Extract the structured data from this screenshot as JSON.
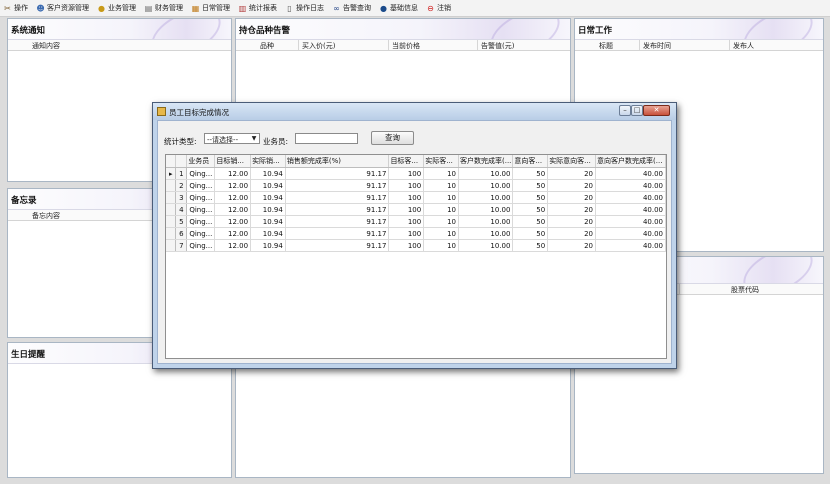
{
  "menubar": {
    "items": [
      {
        "label": "操作",
        "icon": "tools-icon"
      },
      {
        "label": "客户资源管理",
        "icon": "customers-icon"
      },
      {
        "label": "业务管理",
        "icon": "business-icon"
      },
      {
        "label": "财务管理",
        "icon": "finance-icon"
      },
      {
        "label": "日常管理",
        "icon": "daily-icon"
      },
      {
        "label": "统计报表",
        "icon": "chart-icon"
      },
      {
        "label": "操作日志",
        "icon": "log-icon"
      },
      {
        "label": "告警查询",
        "icon": "binoculars-icon"
      },
      {
        "label": "基础信息",
        "icon": "info-icon"
      },
      {
        "label": "注销",
        "icon": "logout-icon"
      }
    ]
  },
  "panels": {
    "notice": {
      "title": "系统通知",
      "columns": [
        "通知内容"
      ]
    },
    "holdings": {
      "title": "持仓品种告警",
      "columns": [
        "品种",
        "买入价(元)",
        "当前价格",
        "告警值(元)"
      ]
    },
    "daily": {
      "title": "日常工作",
      "columns": [
        "标题",
        "发布时间",
        "发布人"
      ]
    },
    "memo": {
      "title": "备忘录",
      "columns": [
        "备忘内容"
      ]
    },
    "stock": {
      "columns": [
        "股票代码"
      ]
    },
    "birthday": {
      "title": "生日提醒"
    }
  },
  "dialog": {
    "title": "员工目标完成情况",
    "filter": {
      "type_label": "统计类型:",
      "type_value": "--请选择--",
      "staff_label": "业务员:",
      "staff_value": "",
      "query_label": "查询"
    },
    "grid": {
      "columns": [
        "业务员",
        "目标销...",
        "实际销...",
        "销售额完成率(%)",
        "目标客...",
        "实际客...",
        "客户数完成率(...",
        "意向客...",
        "实际意向客...",
        "意向客户数完成率(..."
      ],
      "rows": [
        {
          "no": "1",
          "current": true,
          "cells": [
            "Qing...",
            "12.00",
            "10.94",
            "91.17",
            "100",
            "10",
            "10.00",
            "50",
            "20",
            "40.00"
          ]
        },
        {
          "no": "2",
          "current": false,
          "cells": [
            "Qing...",
            "12.00",
            "10.94",
            "91.17",
            "100",
            "10",
            "10.00",
            "50",
            "20",
            "40.00"
          ]
        },
        {
          "no": "3",
          "current": false,
          "cells": [
            "Qing...",
            "12.00",
            "10.94",
            "91.17",
            "100",
            "10",
            "10.00",
            "50",
            "20",
            "40.00"
          ]
        },
        {
          "no": "4",
          "current": false,
          "cells": [
            "Qing...",
            "12.00",
            "10.94",
            "91.17",
            "100",
            "10",
            "10.00",
            "50",
            "20",
            "40.00"
          ]
        },
        {
          "no": "5",
          "current": false,
          "cells": [
            "Qing...",
            "12.00",
            "10.94",
            "91.17",
            "100",
            "10",
            "10.00",
            "50",
            "20",
            "40.00"
          ]
        },
        {
          "no": "6",
          "current": false,
          "cells": [
            "Qing...",
            "12.00",
            "10.94",
            "91.17",
            "100",
            "10",
            "10.00",
            "50",
            "20",
            "40.00"
          ]
        },
        {
          "no": "7",
          "current": false,
          "cells": [
            "Qing...",
            "12.00",
            "10.94",
            "91.17",
            "100",
            "10",
            "10.00",
            "50",
            "20",
            "40.00"
          ]
        }
      ]
    }
  }
}
